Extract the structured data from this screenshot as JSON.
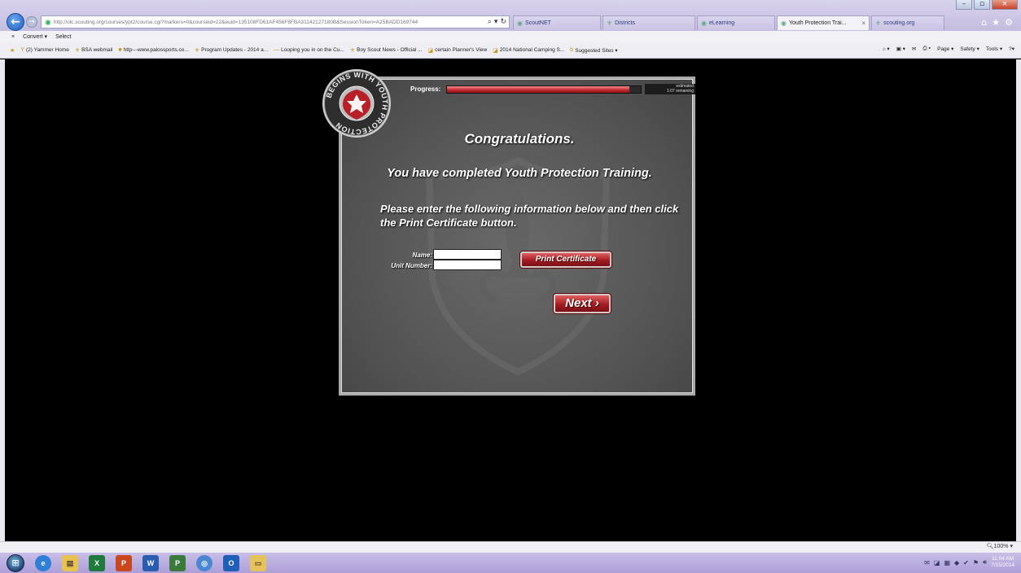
{
  "browser": {
    "address_url": "http://olc.scouting.org/courses/ypt2/course.cgi?markers=0&courseid=22&euid=135108FD61AF456F8FBA31142127180B&SessionToken=A25BADD169744",
    "tabs": [
      {
        "label": "ScoutNET",
        "active": false
      },
      {
        "label": "Districts",
        "active": false
      },
      {
        "label": "eLearning",
        "active": false
      },
      {
        "label": "Youth Protection Trai...",
        "active": true
      },
      {
        "label": "scouting.org",
        "active": false
      }
    ],
    "command_bar": {
      "close": "×",
      "convert": "Convert ▾",
      "select": "Select"
    },
    "favorites": [
      {
        "icon": "yammer-icon",
        "label": "(2) Yammer Home"
      },
      {
        "icon": "bsa-icon",
        "label": "BSA webmail"
      },
      {
        "icon": "site-icon",
        "label": "http---www.palossports.co..."
      },
      {
        "icon": "bsa-icon",
        "label": "Program Updates - 2014 a..."
      },
      {
        "icon": "dash-icon",
        "label": "Looping you in on the Cu..."
      },
      {
        "icon": "bsa-icon",
        "label": "Boy Scout News - Official ..."
      },
      {
        "icon": "site-icon",
        "label": "certain Planner's View"
      },
      {
        "icon": "site-icon",
        "label": "2014 National Camping S..."
      },
      {
        "icon": "bing-icon",
        "label": "Suggested Sites ▾"
      }
    ],
    "tools_menu": [
      "Page ▾",
      "Safety ▾",
      "Tools ▾"
    ],
    "zoom": "100%"
  },
  "course": {
    "progress_label": "Progress:",
    "progress_fraction": 0.94,
    "estimate_line1": "estimated",
    "estimate_line2": "1:07 remaining",
    "badge_text": "BEGINS WITH YOUTH PROTECTION",
    "heading": "Congratulations.",
    "completed_text": "You have completed Youth Protection Training.",
    "instructions": "Please enter the following information below and then click the Print Certificate button.",
    "name_label": "Name:",
    "name_value": "",
    "unit_label": "Unit Number:",
    "unit_value": "",
    "print_button": "Print Certificate",
    "next_button": "Next ›",
    "accent_color": "#a41c22"
  },
  "taskbar": {
    "apps": [
      {
        "name": "ie",
        "label": "e"
      },
      {
        "name": "explorer",
        "label": "▤"
      },
      {
        "name": "excel",
        "label": "X"
      },
      {
        "name": "powerpoint",
        "label": "P"
      },
      {
        "name": "word",
        "label": "W"
      },
      {
        "name": "project",
        "label": "P"
      },
      {
        "name": "lync",
        "label": "◎"
      },
      {
        "name": "outlook",
        "label": "O"
      },
      {
        "name": "folder",
        "label": "▭"
      }
    ],
    "time": "11:04 AM",
    "date": "7/15/2014"
  }
}
